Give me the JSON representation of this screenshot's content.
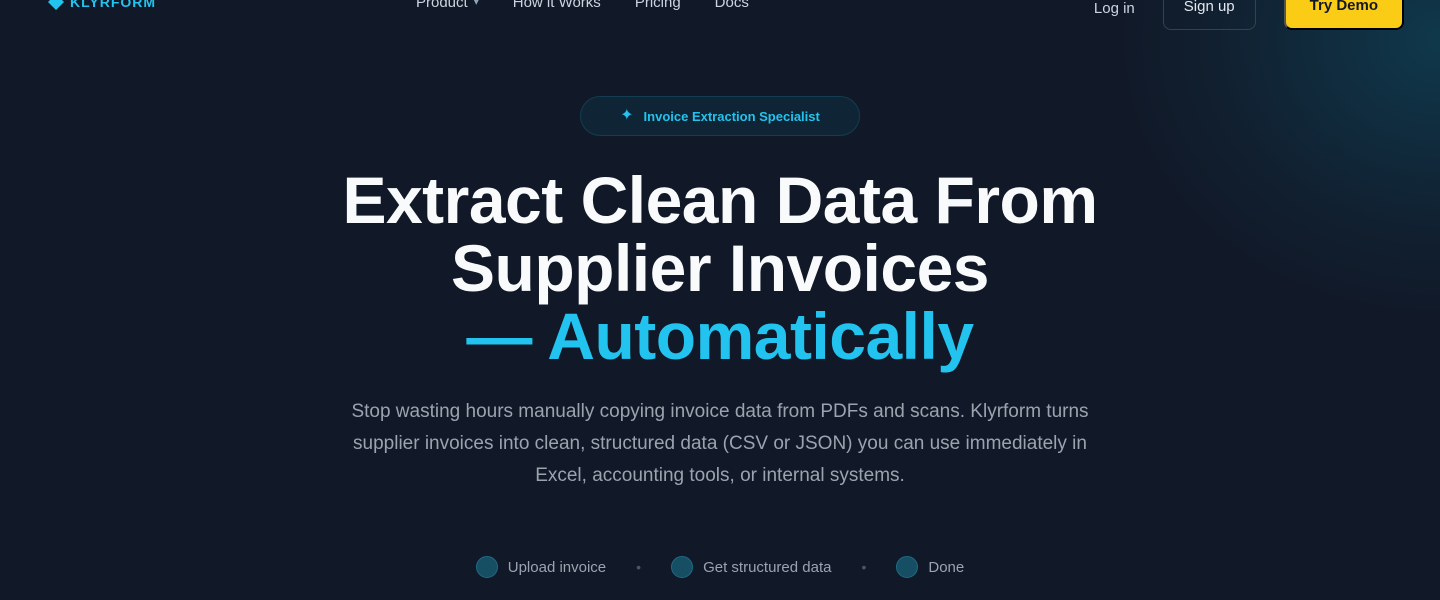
{
  "nav": {
    "logo_text": "KLYRFORM",
    "links": [
      "Product",
      "How it Works",
      "Pricing",
      "Docs"
    ],
    "login": "Log in",
    "signup": "Sign up",
    "demo": "Try Demo"
  },
  "hero": {
    "badge": "Invoice Extraction Specialist",
    "title_line1": "Extract Clean Data From",
    "title_line2": "Supplier Invoices",
    "title_accent": "— Automatically",
    "subtitle": "Stop wasting hours manually copying invoice data from PDFs and scans. Klyrform turns supplier invoices into clean, structured data (CSV or JSON) you can use immediately in Excel, accounting tools, or internal systems.",
    "steps": [
      "Upload invoice",
      "Get structured data",
      "Done"
    ],
    "step_separator": "•"
  },
  "colors": {
    "background": "#111827",
    "accent": "#22c3ee",
    "cta": "#facc15"
  }
}
